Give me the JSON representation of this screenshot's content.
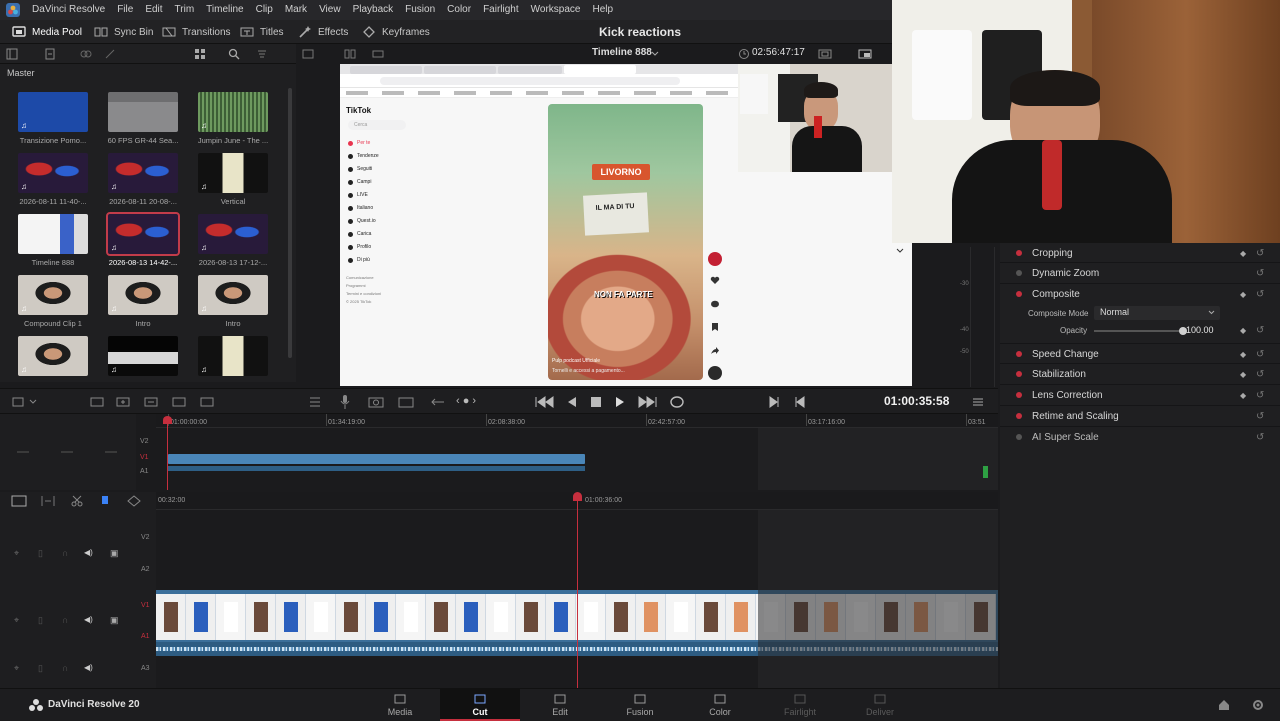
{
  "app": {
    "name": "DaVinci Resolve",
    "version_label": "DaVinci Resolve 20"
  },
  "menu": [
    "DaVinci Resolve",
    "File",
    "Edit",
    "Trim",
    "Timeline",
    "Clip",
    "Mark",
    "View",
    "Playback",
    "Fusion",
    "Color",
    "Fairlight",
    "Workspace",
    "Help"
  ],
  "toolbar": {
    "media_pool": "Media Pool",
    "sync_bin": "Sync Bin",
    "transitions": "Transitions",
    "titles": "Titles",
    "effects": "Effects",
    "keyframes": "Keyframes",
    "project_title": "Kick reactions"
  },
  "media_pool": {
    "bin": "Master",
    "clips": [
      {
        "name": "Transizione Pomo...",
        "kind": "blue"
      },
      {
        "name": "60 FPS GR-44 Sea...",
        "kind": "folder"
      },
      {
        "name": "Jumpin June - The ...",
        "kind": "audio"
      },
      {
        "name": "2026-08-11 11-40-...",
        "kind": "gaming"
      },
      {
        "name": "2026-08-11 20-08-...",
        "kind": "gaming"
      },
      {
        "name": "Vertical",
        "kind": "vertical"
      },
      {
        "name": "Timeline 888",
        "kind": "timeline"
      },
      {
        "name": "2026-08-13 14-42-...",
        "kind": "gaming",
        "selected": true
      },
      {
        "name": "2026-08-13 17-12-...",
        "kind": "gaming"
      },
      {
        "name": "Compound Clip 1",
        "kind": "person"
      },
      {
        "name": "Intro",
        "kind": "person"
      },
      {
        "name": "Intro",
        "kind": "person"
      },
      {
        "name": "",
        "kind": "person"
      },
      {
        "name": "",
        "kind": "dark"
      },
      {
        "name": "",
        "kind": "vertical"
      }
    ]
  },
  "viewer": {
    "timeline_name": "Timeline 888",
    "timecode": "02:56:47:17",
    "tiktok": {
      "logo": "TikTok",
      "search_placeholder": "Cerca",
      "nav": [
        "Per te",
        "Tendenze",
        "Seguiti",
        "Campi",
        "LIVE",
        "Italiano",
        "Quest.io",
        "Carica",
        "Profilo",
        "Di più"
      ],
      "footer": [
        "Comunicazione",
        "Programmi",
        "Termini e condizioni",
        "© 2025 TikTok"
      ],
      "video_location": "LIVORNO",
      "video_sign": "IL MA DI TU",
      "video_caption": "NON FA PARTE",
      "video_author": "Pulp podcast Ufficiale",
      "video_desc": "Tornelli e accessi a pagamento..."
    }
  },
  "inspector": {
    "items": [
      {
        "label": "Cropping",
        "active": true
      },
      {
        "label": "Dynamic Zoom",
        "active": false
      },
      {
        "label": "Composite",
        "active": true
      },
      {
        "label": "Speed Change",
        "active": true
      },
      {
        "label": "Stabilization",
        "active": true
      },
      {
        "label": "Lens Correction",
        "active": true
      },
      {
        "label": "Retime and Scaling",
        "active": true
      },
      {
        "label": "AI Super Scale",
        "active": false
      }
    ],
    "composite_mode_label": "Composite Mode",
    "composite_mode_value": "Normal",
    "opacity_label": "Opacity",
    "opacity_value": "100.00",
    "meter_labels": [
      "-30",
      "-40",
      "-50"
    ]
  },
  "transport": {
    "timecode": "01:00:35:58"
  },
  "timeline": {
    "upper_ruler": [
      "01:00:00:00",
      "01:34:19:00",
      "02:08:38:00",
      "02:42:57:00",
      "03:17:16:00",
      "03:51"
    ],
    "upper_tracks": [
      "V2",
      "V1",
      "A1"
    ],
    "lower_ruler": [
      "00:32:00",
      "01:00:36:00"
    ],
    "lower_tracks": [
      "V2",
      "A2",
      "V1",
      "A1",
      "A3"
    ]
  },
  "pages": [
    {
      "label": "Media",
      "active": false,
      "dim": false
    },
    {
      "label": "Cut",
      "active": true,
      "dim": false
    },
    {
      "label": "Edit",
      "active": false,
      "dim": false
    },
    {
      "label": "Fusion",
      "active": false,
      "dim": false
    },
    {
      "label": "Color",
      "active": false,
      "dim": false
    },
    {
      "label": "Fairlight",
      "active": false,
      "dim": true
    },
    {
      "label": "Deliver",
      "active": false,
      "dim": true
    }
  ],
  "colors": {
    "accent": "#c62f3e",
    "clip_blue": "#4a86b8",
    "panel": "#1f1f21"
  }
}
